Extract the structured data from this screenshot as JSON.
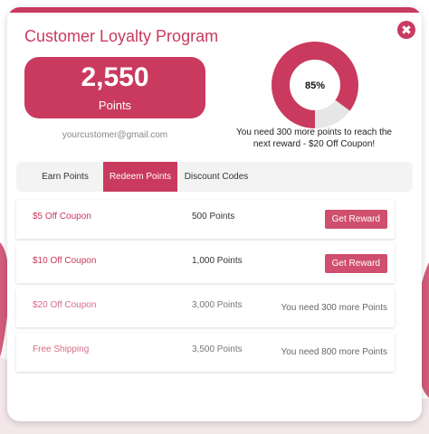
{
  "popup": {
    "title": "Customer Loyalty Program",
    "close_glyph": "✖"
  },
  "points": {
    "value": "2,550",
    "label": "Points",
    "email": "yourcustomer@gmail.com"
  },
  "progress": {
    "percent": 85,
    "label": "85%",
    "message": "You need 300 more points to reach the next reward - $20 Off Coupon!"
  },
  "tabs": [
    {
      "label": "Earn Points",
      "active": false
    },
    {
      "label": "Redeem Points",
      "active": true
    },
    {
      "label": "Discount Codes",
      "active": false
    }
  ],
  "rewards": [
    {
      "title": "$5 Off Coupon",
      "points": "500 Points",
      "button": "Get Reward"
    },
    {
      "title": "$10 Off Coupon",
      "points": "1,000 Points",
      "button": "Get Reward"
    },
    {
      "title": "$20 Off Coupon",
      "points": "3,000 Points",
      "need": "You need 300 more Points"
    },
    {
      "title": "Free Shipping",
      "points": "3,500 Points",
      "need": "You need 800 more Points"
    }
  ],
  "colors": {
    "accent": "#c93a5e",
    "gauge_track": "#e6e6e6"
  },
  "icons": {
    "close": "close-icon"
  }
}
